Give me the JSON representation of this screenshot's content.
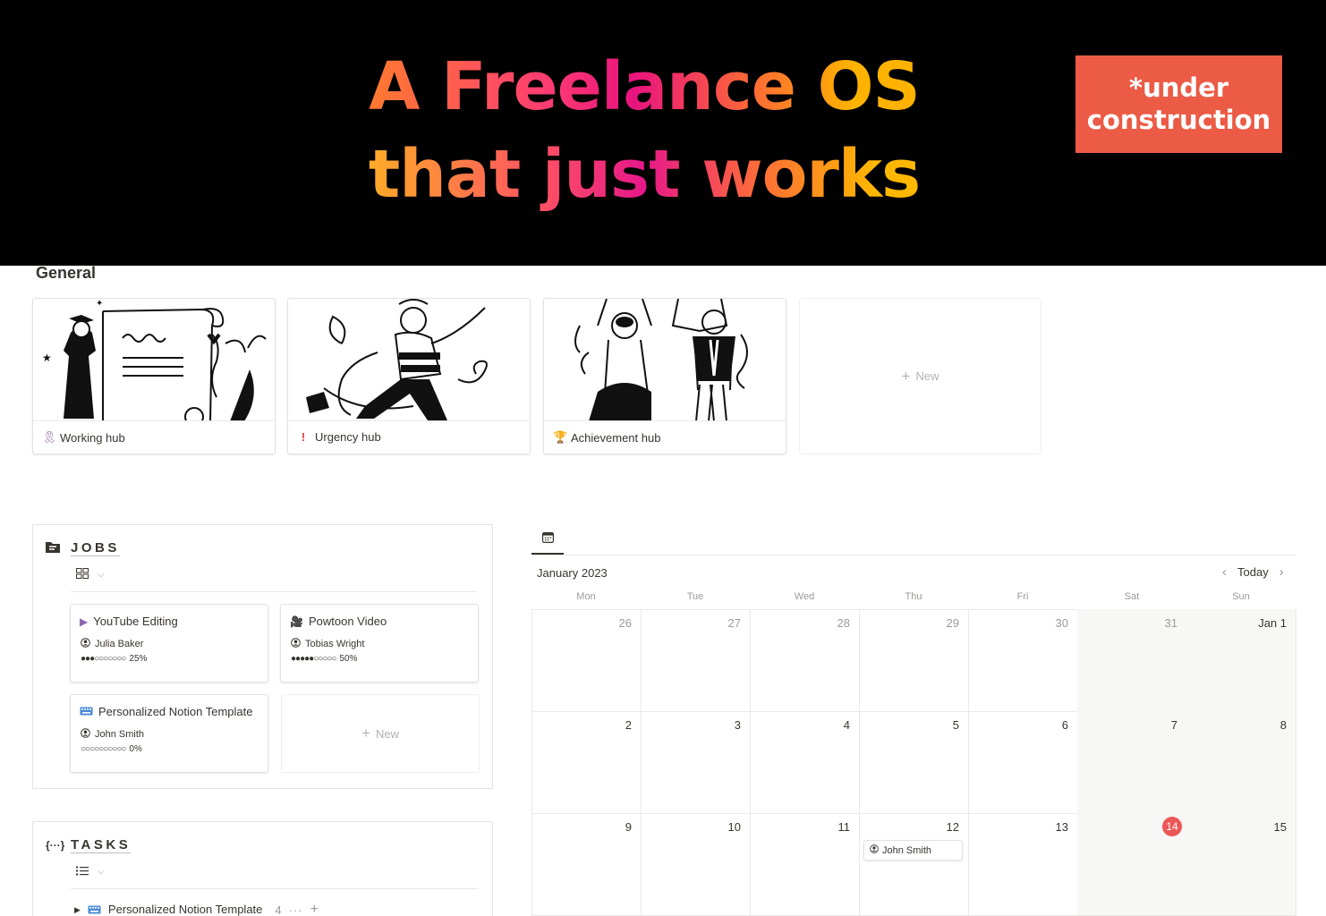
{
  "hero": {
    "line1": "A Freelance OS",
    "line2": "that just works",
    "badge_line1": "*under",
    "badge_line2": "construction",
    "badge_color": "#eb5b45"
  },
  "general": {
    "title": "General",
    "cards": [
      {
        "label": "Working hub",
        "icon": "ribbon-icon"
      },
      {
        "label": "Urgency hub",
        "icon": "exclamation-icon"
      },
      {
        "label": "Achievement hub",
        "icon": "trophy-icon"
      }
    ],
    "new_label": "New"
  },
  "jobs": {
    "title": "JOBS",
    "icon": "folder-icon",
    "view_icon": "gallery-view-icon",
    "cards": [
      {
        "title": "YouTube Editing",
        "icon": "play-icon",
        "person": "Julia Baker",
        "dots": "●●●○○○○○○○",
        "percent": "25%"
      },
      {
        "title": "Powtoon Video",
        "icon": "film-camera-icon",
        "person": "Tobias Wright",
        "dots": "●●●●●○○○○○",
        "percent": "50%"
      },
      {
        "title": "Personalized Notion Template",
        "icon": "keyboard-icon",
        "person": "John Smith",
        "dots": "○○○○○○○○○○",
        "percent": "0%"
      }
    ],
    "new_label": "New"
  },
  "tasks": {
    "title": "TASKS",
    "icon": "braces-icon",
    "view_icon": "list-view-icon",
    "row": {
      "name": "Personalized Notion Template",
      "count": "4",
      "icon": "keyboard-icon"
    }
  },
  "calendar": {
    "month": "January 2023",
    "today_label": "Today",
    "weekdays": [
      "Mon",
      "Tue",
      "Wed",
      "Thu",
      "Fri",
      "Sat",
      "Sun"
    ],
    "weeks": [
      [
        "26",
        "27",
        "28",
        "29",
        "30",
        "31",
        "Jan 1"
      ],
      [
        "2",
        "3",
        "4",
        "5",
        "6",
        "7",
        "8"
      ],
      [
        "9",
        "10",
        "11",
        "12",
        "13",
        "14",
        "15"
      ]
    ],
    "today_day": "14",
    "today_color": "#eb5757",
    "event": {
      "label": "John Smith",
      "day": "12"
    }
  }
}
